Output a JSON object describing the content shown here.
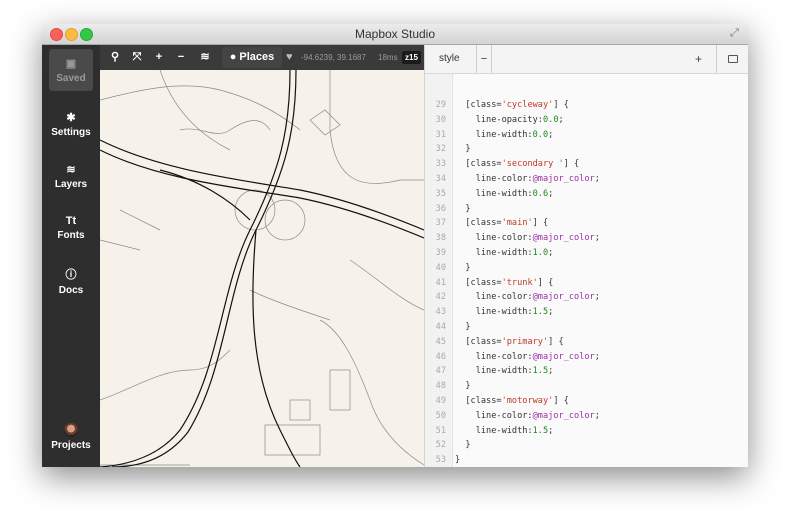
{
  "window": {
    "title": "Mapbox Studio"
  },
  "sidebar": {
    "items": [
      {
        "label": "Saved"
      },
      {
        "label": "Settings"
      },
      {
        "label": "Layers"
      },
      {
        "label": "Fonts"
      },
      {
        "label": "Docs"
      },
      {
        "label": "Projects"
      }
    ],
    "fonts_glyph": "Tt"
  },
  "map_toolbar": {
    "places_label": "Places",
    "coordinates": "-94.6239, 39.1687",
    "render_time": "18ms",
    "zoom": "z15"
  },
  "editor": {
    "tab_label": "style",
    "remove_label": "−",
    "add_label": "+",
    "lines": [
      {
        "n": "29",
        "sel": "[class='cycleway'] {",
        "prop": "",
        "val": ""
      },
      {
        "n": "30",
        "prop": "line-opacity:",
        "val": "0.0"
      },
      {
        "n": "31",
        "prop": "line-width:",
        "val": "0.0"
      },
      {
        "n": "32",
        "close": "}"
      },
      {
        "n": "33",
        "sel": "[class='secondary '] {"
      },
      {
        "n": "34",
        "prop": "line-color:",
        "var": "@major_color"
      },
      {
        "n": "35",
        "prop": "line-width:",
        "val": "0.6"
      },
      {
        "n": "36",
        "close": "}"
      },
      {
        "n": "37",
        "sel": "[class='main'] {"
      },
      {
        "n": "38",
        "prop": "line-color:",
        "var": "@major_color"
      },
      {
        "n": "39",
        "prop": "line-width:",
        "val": "1.0"
      },
      {
        "n": "40",
        "close": "}"
      },
      {
        "n": "41",
        "sel": "[class='trunk'] {"
      },
      {
        "n": "42",
        "prop": "line-color:",
        "var": "@major_color"
      },
      {
        "n": "43",
        "prop": "line-width:",
        "val": "1.5"
      },
      {
        "n": "44",
        "close": "}"
      },
      {
        "n": "45",
        "sel": "[class='primary'] {"
      },
      {
        "n": "46",
        "prop": "line-color:",
        "var": "@major_color"
      },
      {
        "n": "47",
        "prop": "line-width:",
        "val": "1.5"
      },
      {
        "n": "48",
        "close": "}"
      },
      {
        "n": "49",
        "sel": "[class='motorway'] {"
      },
      {
        "n": "50",
        "prop": "line-color:",
        "var": "@major_color"
      },
      {
        "n": "51",
        "prop": "line-width:",
        "val": "1.5"
      },
      {
        "n": "52",
        "close": "}"
      },
      {
        "n": "53",
        "closeOuter": "}"
      }
    ]
  },
  "colors": {
    "sidebar": "#2e2e2e",
    "map_background": "#f6f2ea",
    "selector": "#c0392b",
    "number": "#1d8a1d",
    "variable": "#9b30a8"
  }
}
